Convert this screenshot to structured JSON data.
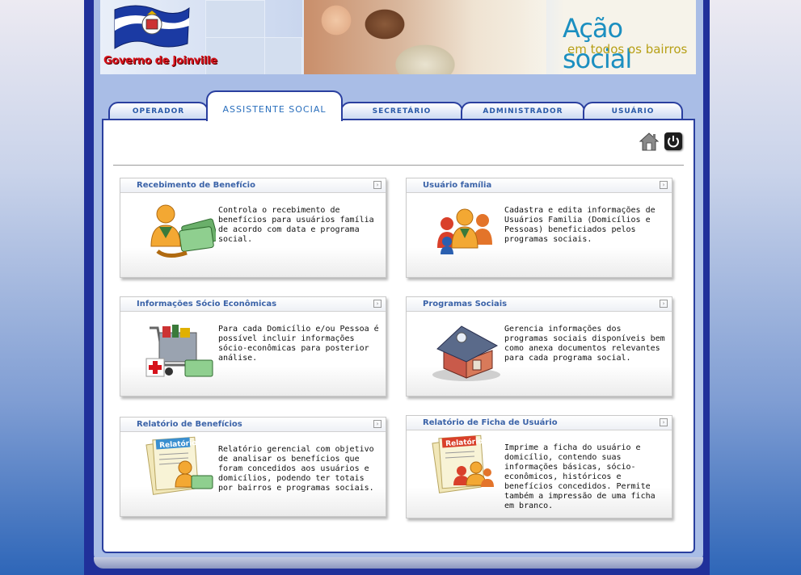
{
  "header": {
    "government_label": "Governo de Joinville",
    "slogan_line1": "Ação social",
    "slogan_line2": "em todos os bairros"
  },
  "tabs": [
    {
      "label": "Operador",
      "active": false
    },
    {
      "label": "Assistente Social",
      "active": true
    },
    {
      "label": "Secretário",
      "active": false
    },
    {
      "label": "Administrador",
      "active": false
    },
    {
      "label": "Usuário",
      "active": false
    }
  ],
  "toolbar": {
    "home_icon": "home-icon",
    "power_icon": "power-icon"
  },
  "cards": [
    {
      "title": "Recebimento de Benefício",
      "icon": "person-receiving-money-icon",
      "description": "Controla o recebimento de benefícios para usuários família de acordo com data e programa social."
    },
    {
      "title": "Usuário família",
      "icon": "family-group-icon",
      "description": "Cadastra e edita informações de Usuários Familia (Domicílios e Pessoas) beneficiados pelos programas sociais."
    },
    {
      "title": "Informações Sócio Econômicas",
      "icon": "shopping-cart-icon",
      "description": "Para cada Domicílio e/ou Pessoa é possível incluir informações sócio-econômicas para posterior análise."
    },
    {
      "title": "Programas Sociais",
      "icon": "house-icon",
      "description": "Gerencia informações dos programas sociais disponíveis bem como anexa documentos relevantes para cada programa social."
    },
    {
      "title": "Relatório de Benefícios",
      "icon": "benefits-report-icon",
      "description": "Relatório gerencial com objetivo de analisar os benefícios que foram concedidos aos usuários e domicílios, podendo ter totais por bairros e programas sociais.",
      "icon_label": "Relatório"
    },
    {
      "title": "Relatório de Ficha de Usuário",
      "icon": "user-report-icon",
      "description": "Imprime a ficha do usuário e domicílio, contendo suas informações básicas, sócio-econômicos, históricos e benefícios concedidos. Permite também a impressão de uma ficha em branco.",
      "icon_label": "Relatório"
    }
  ],
  "colors": {
    "frame": "#20309a",
    "tab_border": "#2a3f9f",
    "card_title": "#3b63a8",
    "slogan_blue": "#1b8fc0",
    "slogan_gold": "#b7a017"
  }
}
